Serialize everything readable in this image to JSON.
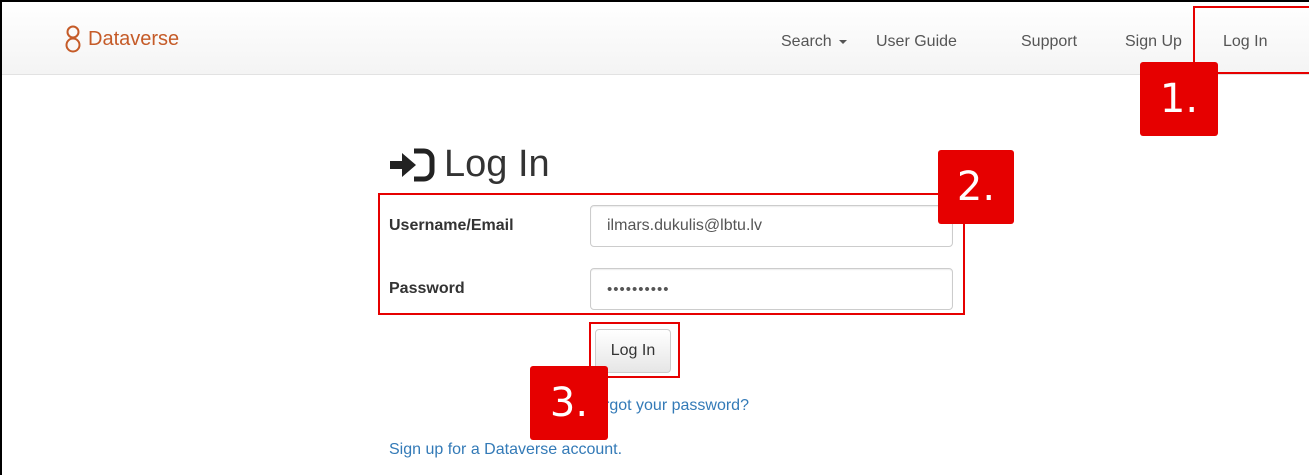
{
  "nav": {
    "brand": "Dataverse",
    "search": "Search",
    "user_guide": "User Guide",
    "support": "Support",
    "sign_up": "Sign Up",
    "log_in": "Log In"
  },
  "login": {
    "title": "Log In",
    "username_label": "Username/Email",
    "username_value": "ilmars.dukulis@lbtu.lv",
    "password_label": "Password",
    "password_value": "••••••••••",
    "submit_label": "Log In",
    "forgot_link": "rgot your password?",
    "signup_link": "Sign up for a Dataverse account."
  },
  "annotations": {
    "step1": "1.",
    "step2": "2.",
    "step3": "3."
  },
  "colors": {
    "brand": "#c55b28",
    "link": "#337ab7",
    "highlight": "#e60000"
  }
}
